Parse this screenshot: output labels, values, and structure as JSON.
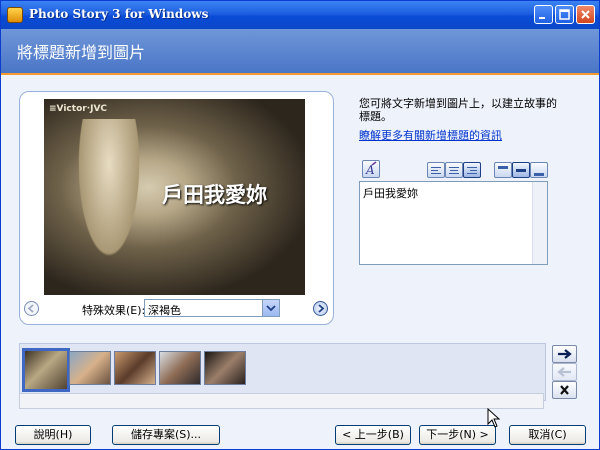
{
  "window": {
    "title": "Photo Story 3 for Windows"
  },
  "header": {
    "title": "將標題新增到圖片"
  },
  "preview": {
    "watermark": "≡Victor·JVC",
    "caption": "戶田我愛妳",
    "effect_label": "特殊效果(E):",
    "effect_value": "深褐色"
  },
  "side": {
    "description": "您可將文字新增到圖片上，以建立故事的標題。",
    "learn_more": "瞭解更多有關新增標題的資訊",
    "title_text": "戶田我愛妳"
  },
  "icons": [
    "app-icon",
    "minimize-icon",
    "maximize-icon",
    "close-icon",
    "arrow-left-icon",
    "arrow-right-icon",
    "dropdown-arrow-icon",
    "font-icon",
    "align-left-icon",
    "align-center-icon",
    "align-right-icon",
    "valign-top-icon",
    "valign-middle-icon",
    "valign-bottom-icon",
    "move-right-icon",
    "move-left-icon",
    "delete-icon",
    "cursor-icon"
  ],
  "filmstrip": {
    "count": 5,
    "selected": 1
  },
  "buttons": {
    "help": "說明(H)",
    "save": "儲存專案(S)...",
    "back": "< 上一步(B)",
    "next": "下一步(N) >",
    "cancel": "取消(C)"
  },
  "colors": {
    "accent": "#f49a2e",
    "title_bar": "#1e5fe0",
    "header": "#5b86cf"
  }
}
